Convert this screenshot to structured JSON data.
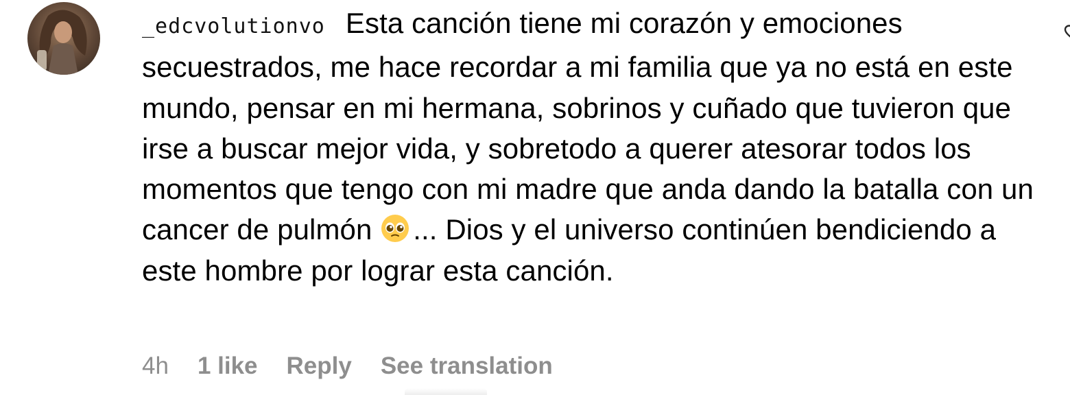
{
  "comment": {
    "username": "_edcvolutionvo",
    "text_line1": "Esta canción tiene mi corazón y emociones",
    "text_rest": "secuestrados, me hace recordar a mi familia que ya no está en este mundo, pensar en mi hermana, sobrinos y cuñado que tuvieron que irse a buscar mejor vida, y sobretodo a querer atesorar todos los momentos que tengo con mi madre que anda dando la batalla con un cancer de pulmón",
    "emoji": "pleading-face-emoji",
    "text_end": "... Dios y el universo continúen bendiciendo a este hombre por lograr esta canción.",
    "time": "4h",
    "likes": "1 like",
    "reply_label": "Reply",
    "translate_label": "See translation"
  },
  "icons": {
    "avatar": "profile-photo",
    "like": "heart-icon"
  },
  "colors": {
    "text": "#000000",
    "meta": "#8e8e8e",
    "background": "#ffffff"
  }
}
